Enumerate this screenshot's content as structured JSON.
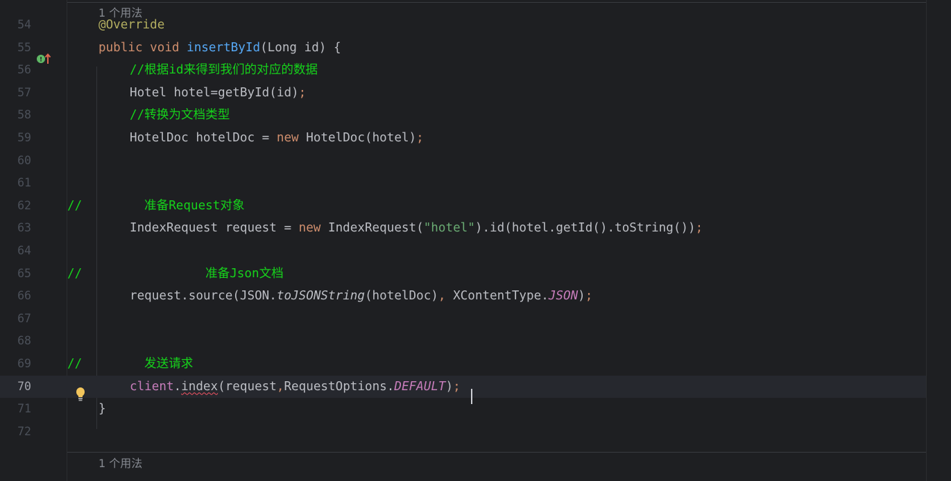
{
  "usage_hint_top": "1 个用法",
  "usage_hint_bottom": "1 个用法",
  "lines": [
    {
      "num": "54",
      "tokens": [
        {
          "t": "@Override",
          "c": "ann"
        }
      ]
    },
    {
      "num": "55",
      "tokens": [
        {
          "t": "public ",
          "c": "kw"
        },
        {
          "t": "void ",
          "c": "kw"
        },
        {
          "t": "insertById",
          "c": "fn"
        },
        {
          "t": "(Long id) {",
          "c": ""
        }
      ]
    },
    {
      "num": "56",
      "tokens": [
        {
          "t": "//根据",
          "c": "cm"
        },
        {
          "t": "id",
          "c": "cm b"
        },
        {
          "t": "来得到我们的对应的数据",
          "c": "cm"
        }
      ]
    },
    {
      "num": "57",
      "tokens": [
        {
          "t": "Hotel hotel=getById(id)",
          "c": ""
        },
        {
          "t": ";",
          "c": "kw"
        }
      ]
    },
    {
      "num": "58",
      "tokens": [
        {
          "t": "//转换为文档类型",
          "c": "cm"
        }
      ]
    },
    {
      "num": "59",
      "tokens": [
        {
          "t": "HotelDoc hotelDoc = ",
          "c": ""
        },
        {
          "t": "new ",
          "c": "kw"
        },
        {
          "t": "HotelDoc(hotel)",
          "c": ""
        },
        {
          "t": ";",
          "c": "kw"
        }
      ]
    },
    {
      "num": "60",
      "tokens": []
    },
    {
      "num": "61",
      "tokens": []
    },
    {
      "num": "62",
      "tokens": [
        {
          "t": "//",
          "c": "cm"
        }
      ],
      "extra": [
        {
          "t": "准备",
          "c": "cm"
        },
        {
          "t": "Request",
          "c": "cm b"
        },
        {
          "t": "对象",
          "c": "cm"
        }
      ]
    },
    {
      "num": "63",
      "tokens": [
        {
          "t": "IndexRequest request = ",
          "c": ""
        },
        {
          "t": "new ",
          "c": "kw"
        },
        {
          "t": "IndexRequest(",
          "c": ""
        },
        {
          "t": "\"hotel\"",
          "c": "str"
        },
        {
          "t": ").id(hotel.getId().toString())",
          "c": ""
        },
        {
          "t": ";",
          "c": "kw"
        }
      ]
    },
    {
      "num": "64",
      "tokens": []
    },
    {
      "num": "65",
      "tokens": [
        {
          "t": "//",
          "c": "cm"
        }
      ],
      "extra": [
        {
          "t": "准备",
          "c": "cm"
        },
        {
          "t": "Json",
          "c": "cm b"
        },
        {
          "t": "文档",
          "c": "cm"
        }
      ]
    },
    {
      "num": "66",
      "tokens": [
        {
          "t": "request.source(JSON.",
          "c": ""
        },
        {
          "t": "toJSONString",
          "c": "italic"
        },
        {
          "t": "(hotelDoc)",
          "c": ""
        },
        {
          "t": ", ",
          "c": "kw"
        },
        {
          "t": "XContentType.",
          "c": ""
        },
        {
          "t": "JSON",
          "c": "st"
        },
        {
          "t": ")",
          "c": ""
        },
        {
          "t": ";",
          "c": "kw"
        }
      ]
    },
    {
      "num": "67",
      "tokens": []
    },
    {
      "num": "68",
      "tokens": []
    },
    {
      "num": "69",
      "tokens": [
        {
          "t": "//",
          "c": "cm"
        }
      ],
      "extra": [
        {
          "t": "发送请求",
          "c": "cm"
        }
      ]
    },
    {
      "num": "70",
      "tokens": [
        {
          "t": "client",
          "c": "fld"
        },
        {
          "t": ".",
          "c": ""
        },
        {
          "t": "index",
          "c": "err"
        },
        {
          "t": "(request",
          "c": ""
        },
        {
          "t": ",",
          "c": "kw"
        },
        {
          "t": "RequestOptions.",
          "c": ""
        },
        {
          "t": "DEFAULT",
          "c": "st"
        },
        {
          "t": ")",
          "c": ""
        },
        {
          "t": ";",
          "c": "kw"
        }
      ],
      "current": true
    },
    {
      "num": "71",
      "tokens": [
        {
          "t": "}",
          "c": ""
        }
      ]
    },
    {
      "num": "72",
      "tokens": []
    }
  ],
  "icons": {
    "override_marker": "override-method-icon",
    "intention_bulb": "lightbulb-icon"
  },
  "colors": {
    "background": "#1e1f22",
    "keyword": "#cf8e6d",
    "comment": "#16d21b",
    "annotation": "#b3ae60",
    "method_decl": "#56a8f5",
    "string": "#6aab73",
    "static_field": "#c77dbb",
    "text": "#bcbec4"
  }
}
